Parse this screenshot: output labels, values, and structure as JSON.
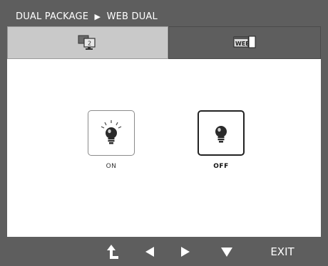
{
  "title": {
    "left": "DUAL PACKAGE",
    "arrow": "▶",
    "right": "WEB DUAL"
  },
  "tabs": [
    {
      "icon": "dual-monitor-icon",
      "badge": "2"
    },
    {
      "icon": "web-icon",
      "badge": "WEB"
    }
  ],
  "options": [
    {
      "label": "ON",
      "icon": "lightbulb-on-icon"
    },
    {
      "label": "OFF",
      "icon": "lightbulb-off-icon",
      "selected": true
    }
  ],
  "bottom": {
    "buttons": [
      "return-icon",
      "left-arrow-icon",
      "right-arrow-icon",
      "down-arrow-icon"
    ],
    "exit_label": "EXIT"
  },
  "colors": {
    "frame": "#5e5e5e",
    "active_tab": "#c9c9c9",
    "content": "#ffffff"
  }
}
